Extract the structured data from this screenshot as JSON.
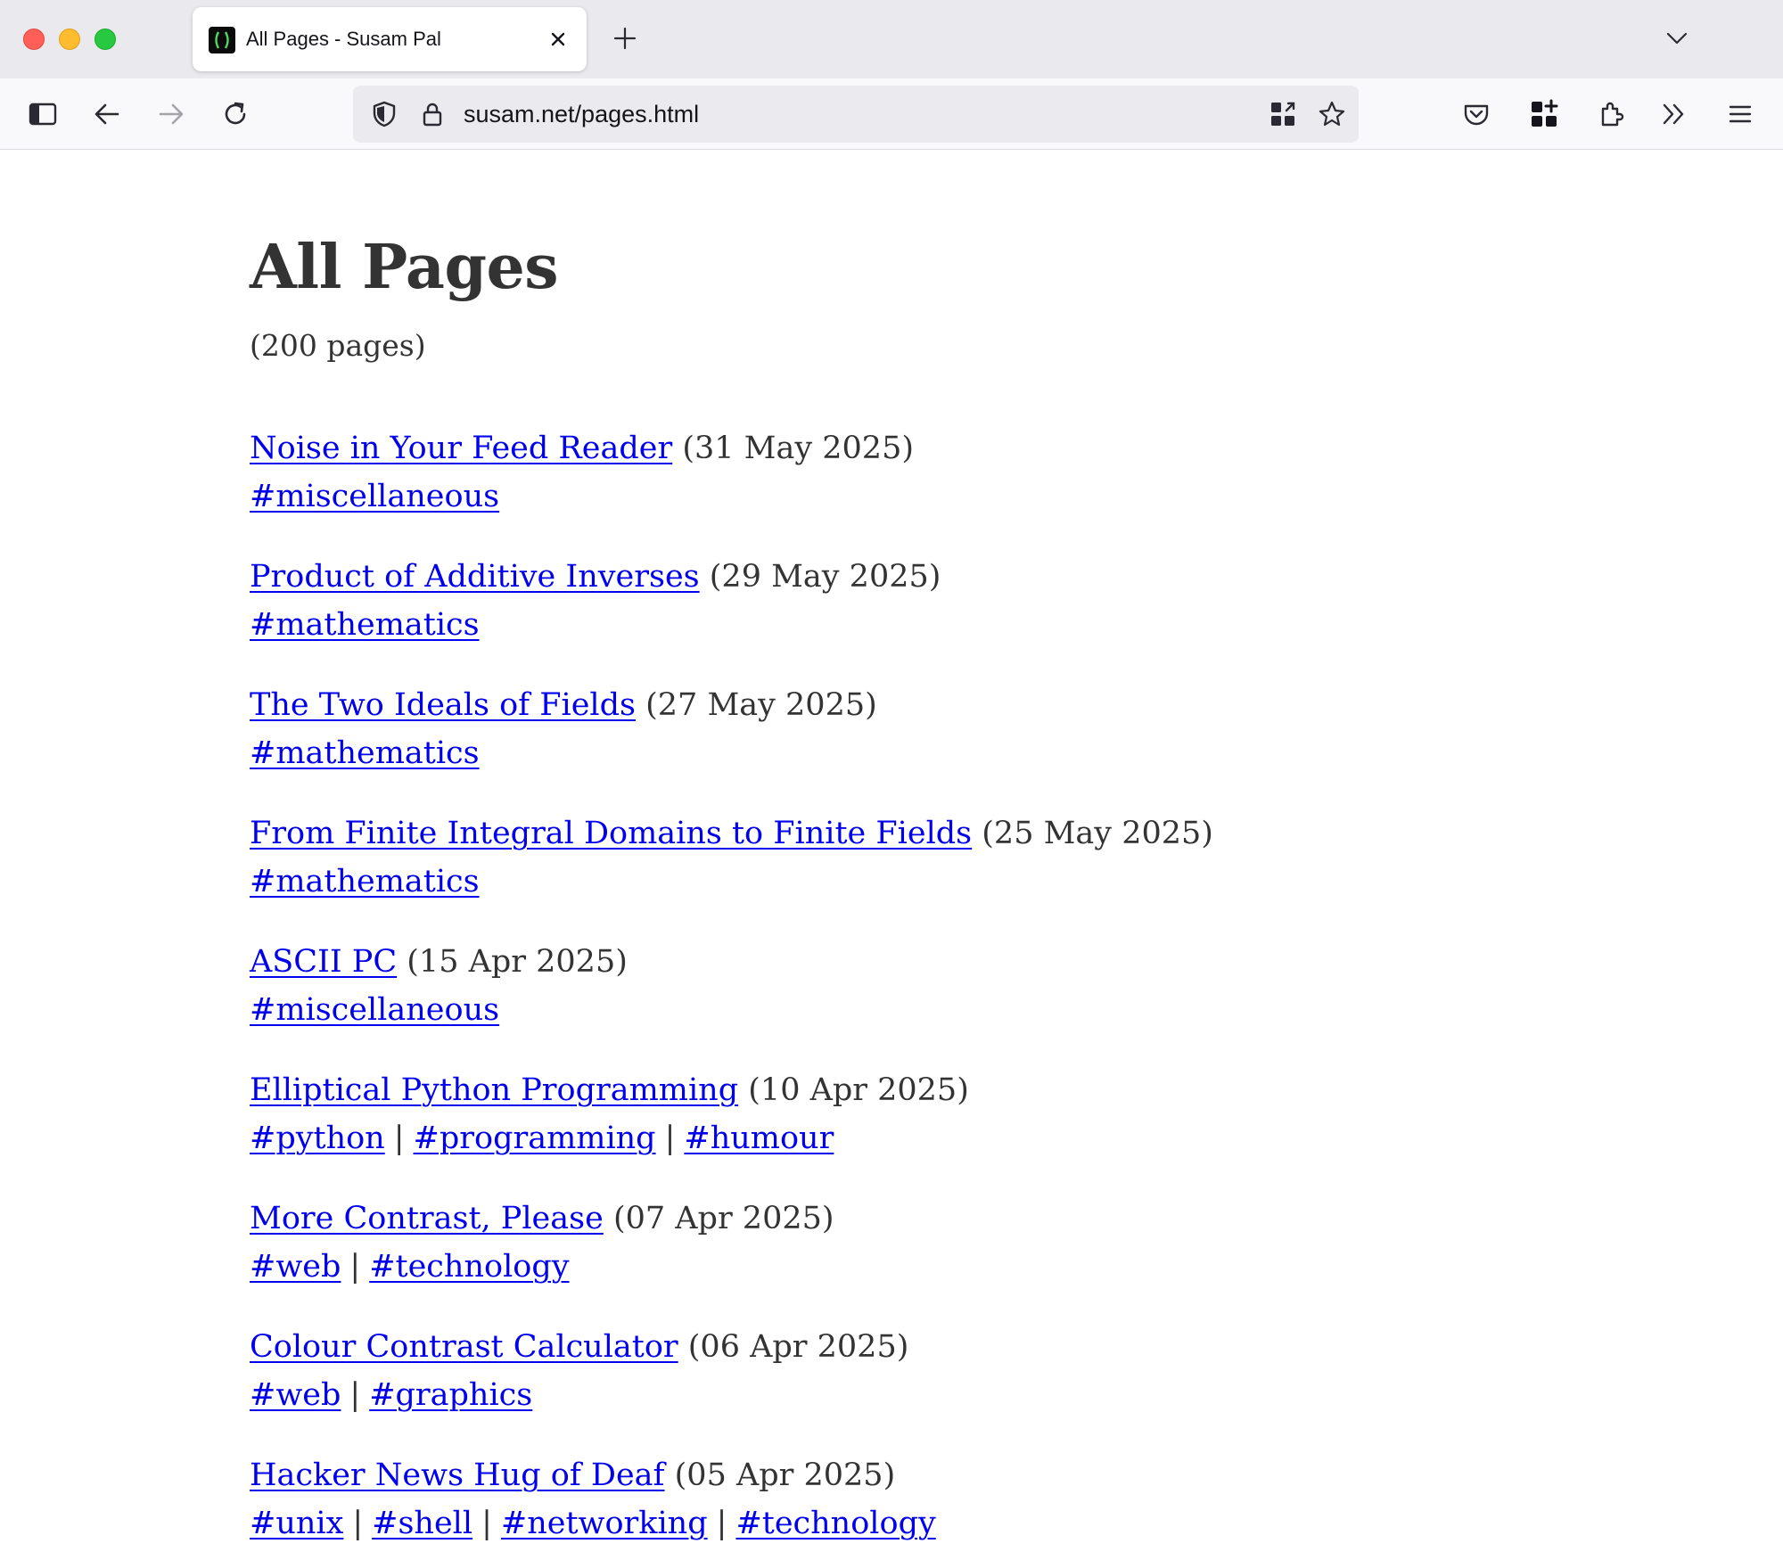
{
  "browser": {
    "tab": {
      "title": "All Pages - Susam Pal"
    },
    "address_bar": {
      "url": "susam.net/pages.html"
    },
    "icons": {
      "sidebar": "sidebar-icon",
      "back": "back-arrow-icon",
      "forward": "forward-arrow-icon",
      "reload": "reload-icon",
      "shield": "shield-icon",
      "lock": "lock-icon",
      "qr": "qr-code-icon",
      "bookmark": "star-icon",
      "pocket": "pocket-icon",
      "extensions_grid": "extensions-grid-icon",
      "extension": "puzzle-icon",
      "overflow": "double-chevron-icon",
      "menu": "hamburger-menu-icon"
    }
  },
  "page": {
    "title": "All Pages",
    "count": "(200 pages)",
    "entries": [
      {
        "title": "Noise in Your Feed Reader",
        "date": "(31 May 2025)",
        "tags": [
          "#miscellaneous"
        ]
      },
      {
        "title": "Product of Additive Inverses",
        "date": "(29 May 2025)",
        "tags": [
          "#mathematics"
        ]
      },
      {
        "title": "The Two Ideals of Fields",
        "date": "(27 May 2025)",
        "tags": [
          "#mathematics"
        ]
      },
      {
        "title": "From Finite Integral Domains to Finite Fields",
        "date": "(25 May 2025)",
        "tags": [
          "#mathematics"
        ]
      },
      {
        "title": "ASCII PC",
        "date": "(15 Apr 2025)",
        "tags": [
          "#miscellaneous"
        ]
      },
      {
        "title": "Elliptical Python Programming",
        "date": "(10 Apr 2025)",
        "tags": [
          "#python",
          "#programming",
          "#humour"
        ]
      },
      {
        "title": "More Contrast, Please",
        "date": "(07 Apr 2025)",
        "tags": [
          "#web",
          "#technology"
        ]
      },
      {
        "title": "Colour Contrast Calculator",
        "date": "(06 Apr 2025)",
        "tags": [
          "#web",
          "#graphics"
        ]
      },
      {
        "title": "Hacker News Hug of Deaf",
        "date": "(05 Apr 2025)",
        "tags": [
          "#unix",
          "#shell",
          "#networking",
          "#technology"
        ]
      }
    ],
    "separator": "|"
  },
  "colors": {
    "link": "#0000ee",
    "text": "#333333",
    "tabbar": "#eaeaee",
    "navbar": "#f9f9fb"
  }
}
